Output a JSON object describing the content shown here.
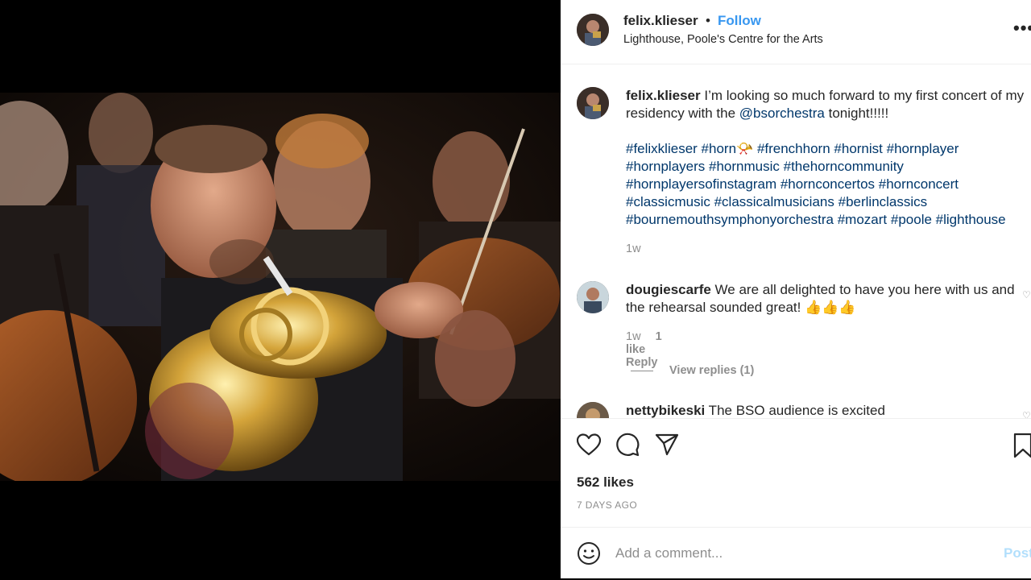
{
  "post": {
    "username": "felix.klieser",
    "dot": "•",
    "follow_label": "Follow",
    "location": "Lighthouse, Poole's Centre for the Arts",
    "more_label": "•••"
  },
  "caption": {
    "username": "felix.klieser",
    "text_1": " I’m looking so much forward to my first concert of my residency with the ",
    "mention": "@bsorchestra",
    "text_2": " tonight!!!!!",
    "hashtags": [
      "#felixklieser",
      "#horn📯",
      "#frenchhorn",
      "#hornist",
      "#hornplayer",
      "#hornplayers",
      "#hornmusic",
      "#thehorncommunity",
      "#hornplayersofinstagram",
      "#hornconcertos",
      "#hornconcert",
      "#classicmusic",
      "#classicalmusicians",
      "#berlinclassics",
      "#bournemouthsymphonyorchestra",
      "#mozart",
      "#poole",
      "#lighthouse"
    ],
    "time": "1w"
  },
  "comments": [
    {
      "username": "dougiescarfe",
      "text": " We are all delighted to have you here with us and the rehearsal sounded great! 👍👍👍",
      "time": "1w",
      "likes": "1 like",
      "reply_label": "Reply",
      "view_replies": "View replies (1)"
    },
    {
      "username": "nettybikeski",
      "text": " The BSO audience is excited"
    }
  ],
  "actions": {
    "like_icon": "heart-icon",
    "comment_icon": "comment-icon",
    "share_icon": "share-icon",
    "save_icon": "bookmark-icon",
    "likes_count": "562 likes",
    "posted_ago": "7 DAYS AGO"
  },
  "add_comment": {
    "placeholder": "Add a comment...",
    "post_label": "Post"
  }
}
